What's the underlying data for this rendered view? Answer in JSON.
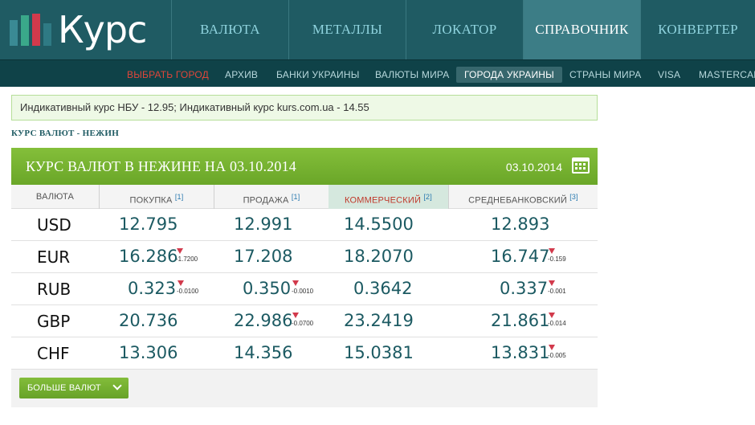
{
  "header": {
    "logo_text": "Курс",
    "logo_colors": [
      "#3a8a94",
      "#3aa88a",
      "#d23a4c",
      "#2f7a84"
    ],
    "nav": [
      {
        "label": "Валюта"
      },
      {
        "label": "Металлы"
      },
      {
        "label": "Локатор"
      },
      {
        "label": "Справочник",
        "active": true
      },
      {
        "label": "Конвертер"
      }
    ]
  },
  "subnav": {
    "items": [
      {
        "label": "Выбрать город",
        "type": "city"
      },
      {
        "label": "Архив"
      },
      {
        "label": "Банки Украины"
      },
      {
        "label": "Валюты мира"
      },
      {
        "label": "Города Украины",
        "active": true
      },
      {
        "label": "Страны мира"
      },
      {
        "label": "VISA"
      },
      {
        "label": "MASTERCARD"
      }
    ]
  },
  "notice": "Индикативный курс НБУ - 12.95; Индикативный курс kurs.com.ua - 14.55",
  "breadcrumb": "Курс валют - Нежин",
  "table": {
    "title": "Курс валют в Нежине на 03.10.2014",
    "date": "03.10.2014",
    "columns": [
      {
        "label": "Валюта",
        "note": ""
      },
      {
        "label": "Покупка",
        "note": "[1]"
      },
      {
        "label": "Продажа",
        "note": "[1]"
      },
      {
        "label": "Коммерческий",
        "note": "[2]"
      },
      {
        "label": "Среднебанковский",
        "note": "[3]"
      }
    ],
    "rows": [
      {
        "currency": "USD",
        "buy": "12.795",
        "buy_change": "",
        "sell": "12.991",
        "sell_change": "",
        "commercial": "14.5500",
        "average": "12.893",
        "average_change": ""
      },
      {
        "currency": "EUR",
        "buy": "16.286",
        "buy_change": "-1.7200",
        "sell": "17.208",
        "sell_change": "",
        "commercial": "18.2070",
        "average": "16.747",
        "average_change": "-0.159"
      },
      {
        "currency": "RUB",
        "buy": "0.323",
        "buy_change": "-0.0100",
        "sell": "0.350",
        "sell_change": "-0.0010",
        "commercial": "0.3642",
        "average": "0.337",
        "average_change": "-0.001"
      },
      {
        "currency": "GBP",
        "buy": "20.736",
        "buy_change": "",
        "sell": "22.986",
        "sell_change": "-0.0700",
        "commercial": "23.2419",
        "average": "21.861",
        "average_change": "-0.014"
      },
      {
        "currency": "CHF",
        "buy": "13.306",
        "buy_change": "",
        "sell": "14.356",
        "sell_change": "",
        "commercial": "15.0381",
        "average": "13.831",
        "average_change": "-0.005"
      }
    ],
    "more_button": "Больше валют"
  },
  "colors": {
    "header_bg": "#1f5b63",
    "subnav_bg": "#0f4248",
    "accent_green": "#74b232",
    "value_text": "#1c5a62",
    "decline_red": "#d23a4c"
  }
}
